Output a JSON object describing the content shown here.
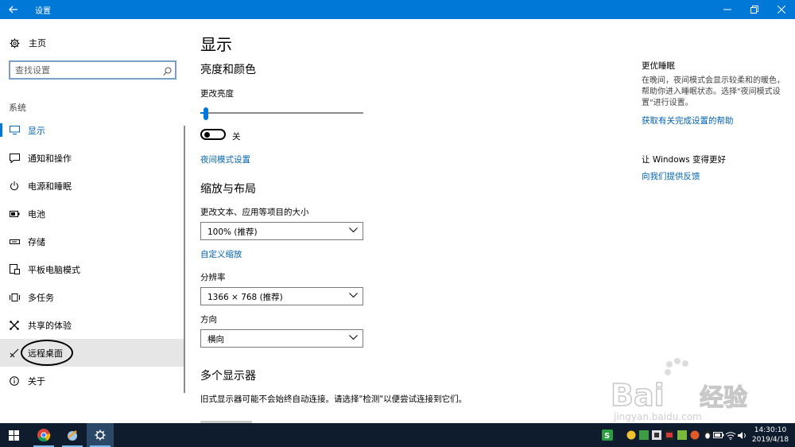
{
  "window": {
    "title": "设置"
  },
  "sidebar": {
    "home_label": "主页",
    "search_placeholder": "查找设置",
    "section_label": "系统",
    "items": [
      {
        "label": "显示",
        "icon": "monitor-icon",
        "state": "active"
      },
      {
        "label": "通知和操作",
        "icon": "notification-icon"
      },
      {
        "label": "电源和睡眠",
        "icon": "power-icon"
      },
      {
        "label": "电池",
        "icon": "battery-icon"
      },
      {
        "label": "存储",
        "icon": "storage-icon"
      },
      {
        "label": "平板电脑模式",
        "icon": "tablet-mode-icon"
      },
      {
        "label": "多任务",
        "icon": "multitasking-icon"
      },
      {
        "label": "共享的体验",
        "icon": "shared-experiences-icon"
      },
      {
        "label": "远程桌面",
        "icon": "remote-desktop-icon",
        "state": "hover"
      },
      {
        "label": "关于",
        "icon": "info-icon"
      }
    ]
  },
  "main": {
    "title": "显示",
    "brightness_heading": "亮度和颜色",
    "brightness_label": "更改亮度",
    "brightness_percent": 2,
    "night_light_state": "关",
    "night_light_link": "夜间模式设置",
    "scale_heading": "缩放与布局",
    "scale_label": "更改文本、应用等项目的大小",
    "scale_value": "100% (推荐)",
    "custom_scale_link": "自定义缩放",
    "resolution_label": "分辨率",
    "resolution_value": "1366 × 768 (推荐)",
    "orientation_label": "方向",
    "orientation_value": "横向",
    "multi_display_heading": "多个显示器",
    "multi_display_text": "旧式显示器可能不会始终自动连接。请选择\"检测\"以便尝试连接到它们。"
  },
  "right_pane": {
    "sleep_title": "更优睡眠",
    "sleep_text": "在晚间，夜间模式会显示较柔和的暖色，帮助你进入睡眠状态。选择\"夜间模式设置\"进行设置。",
    "sleep_link": "获取有关完成设置的帮助",
    "improve_title": "让 Windows 变得更好",
    "feedback_link": "向我们提供反馈"
  },
  "watermark": {
    "text_main": "Bai",
    "text_cn": "经验",
    "url": "jingyan.baidu.com"
  },
  "taskbar": {
    "time": "14:30:10",
    "date": "2019/4/18"
  },
  "colors": {
    "accent": "#0078d7",
    "link": "#0063b1",
    "taskbar": "#0f1c2e"
  }
}
